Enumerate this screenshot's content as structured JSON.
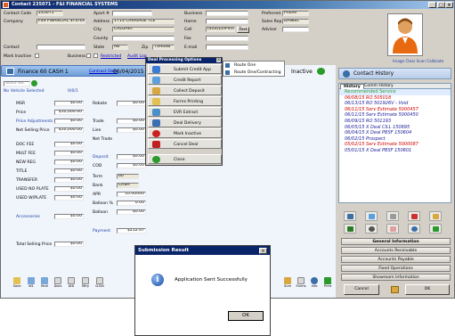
{
  "window": {
    "title": "Contact 235071 - F&I FINANCIAL SYSTEMS"
  },
  "contact": {
    "code_label": "Contact Code",
    "code": "235071",
    "company_label": "Company",
    "company": "FSS FINANCIAL SYSTEMS",
    "contact_label": "Contact",
    "contact": "",
    "mark_inactive": "Mark Inactive",
    "business": "Business",
    "apt_label": "Apart #",
    "address_label": "Address",
    "address": "1713 CARRIAGE TLE",
    "city_label": "City",
    "city": "CALGARY",
    "county_label": "County",
    "state_label": "State",
    "state": "AB",
    "zip_label": "Zip",
    "zip": "T3H4N6",
    "restricted": "Restricted",
    "audit_log": "Audit Log",
    "business_label": "Business",
    "home_label": "Home",
    "cell_label": "Cell",
    "cell": "(403)229-9193",
    "text_btn": "Text",
    "fax_label": "Fax",
    "email_label": "E-mail",
    "email": "",
    "preferred_label": "Preferred",
    "preferred": "Phone",
    "sales_rep_label": "Sales Rep",
    "sales_rep": "DANIEL",
    "advisor_label": "Advisor",
    "image_links": "Image Clear Scan Calibrate"
  },
  "deal": {
    "title": "Finance 60 CASH 1",
    "contract_date_label": "Contract Date",
    "contract_date": "06/04/2015",
    "inactive": "Inactive",
    "stock_placeholder": "Stock No.",
    "vehicle": "No Vehicle Selected",
    "vehicle_count": "0/0/1"
  },
  "pricing": [
    {
      "label": "MSR",
      "value": "$0.00"
    },
    {
      "label": "Price",
      "value": "$10,000.00"
    },
    {
      "label": "Price Adjustments",
      "value": "$0.00"
    },
    {
      "label": "Net Selling Price",
      "value": "$10,000.00"
    },
    {
      "label": "DOC FEE",
      "value": "$0.00"
    },
    {
      "label": "MULT FEE",
      "value": "$0.00"
    },
    {
      "label": "NEW REG",
      "value": "$0.00"
    },
    {
      "label": "TITLE",
      "value": "$0.00"
    },
    {
      "label": "TRANSFER",
      "value": "$0.00"
    },
    {
      "label": "USED NO PLATE",
      "value": "$0.00"
    },
    {
      "label": "USED W/PLATE",
      "value": "$0.00"
    },
    {
      "label": "Accessories",
      "value": "$0.00"
    },
    {
      "label": "Total Selling Price",
      "value": "$0.00"
    }
  ],
  "finance": {
    "rebate_label": "Rebate",
    "rebate": "$0.00",
    "trade_label": "Trade",
    "trade": "$0.00",
    "lien_label": "Lien",
    "lien": "$0.00",
    "net_trade_label": "Net Trade",
    "deposit_label": "Deposit",
    "deposit": "$0.00",
    "cod_label": "COD",
    "cod": "$0.00",
    "term_label": "Term",
    "term": "60",
    "bank_label": "Bank",
    "bank": "CASH",
    "apr_label": "APR",
    "apr": "10.00000",
    "balloon_pct_label": "Balloon %",
    "balloon_pct": "0.00",
    "balloon_label": "Balloon",
    "balloon": "$0.00",
    "payment_label": "Payment",
    "payment": "$212.47"
  },
  "menu": {
    "title": "Deal Processing Options",
    "items": [
      {
        "label": "Submit Credit App",
        "color": "#3a7bd5"
      },
      {
        "label": "Credit Report",
        "color": "#5aa0e0"
      },
      {
        "label": "Collect Deposit",
        "color": "#d9a640"
      },
      {
        "label": "Forms Printing",
        "color": "#e3c050"
      },
      {
        "label": "EVR Extract",
        "color": "#4a90c8"
      },
      {
        "label": "Deal Delivery",
        "color": "#3a6fb5"
      },
      {
        "label": "Mark Inactive",
        "color": "#cc2020"
      },
      {
        "label": "Cancel Deal",
        "color": "#c02020"
      },
      {
        "label": "Close",
        "color": "#2a9a2a"
      }
    ],
    "submenu": [
      "Route One",
      "Route One/Contracting"
    ]
  },
  "history": {
    "title": "Contact History",
    "tabs": [
      "History",
      "Comm History"
    ],
    "lines": [
      {
        "text": "Recommended Service",
        "color": "#2a9a2a",
        "bg": "#e0ecff"
      },
      {
        "text": "06/08/15 RO 505018",
        "color": "#d00000"
      },
      {
        "text": "06/13/15 RO 501926V - Void",
        "color": "#1a1a9a"
      },
      {
        "text": "06/11/15 Serv Estimate 5000457",
        "color": "#d00000"
      },
      {
        "text": "06/11/15 Serv Estimate 5000450",
        "color": "#1a1a9a"
      },
      {
        "text": "06/09/15 RO 501193",
        "color": "#1a1a9a"
      },
      {
        "text": "06/05/15 X Deal CILL 150695",
        "color": "#1a1a9a"
      },
      {
        "text": "06/04/15 X Deal PBSF 150604",
        "color": "#1a1a9a"
      },
      {
        "text": "06/02/15 Prospect",
        "color": "#1a1a9a"
      },
      {
        "text": "05/02/15 Serv Estimate 5000087",
        "color": "#d00000"
      },
      {
        "text": "05/01/15 X Deal PBSF 150601",
        "color": "#1a1a9a"
      }
    ]
  },
  "actions": [
    "General Information",
    "Accounts Receivable",
    "Accounts Payable",
    "Fixed Operations",
    "Showroom Information"
  ],
  "bottom": {
    "cancel": "Cancel",
    "ok": "OK"
  },
  "toolbar_left": [
    "Save",
    "W1",
    "Mult",
    "Docs",
    "Attl",
    "Mtry",
    "D.Bill"
  ],
  "toolbar_right": [
    "Sum",
    "Forms",
    "Info",
    "Print"
  ],
  "dialog": {
    "title": "Submission Result",
    "message": "Application Sent Successfully",
    "ok": "OK"
  }
}
